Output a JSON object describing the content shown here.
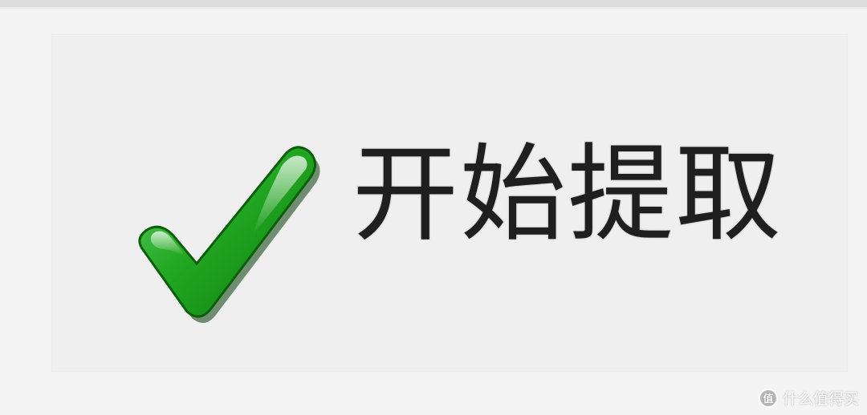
{
  "button": {
    "label": "开始提取",
    "icon": "checkmark-icon",
    "icon_color": "#1e9e1e",
    "background": "#efefef"
  },
  "watermark": {
    "text": "什么值得买",
    "logo_glyph": "值"
  },
  "colors": {
    "page_background": "#f4f4f4",
    "top_bar": "#dcdcdc",
    "label_text": "#1f1f1f"
  }
}
